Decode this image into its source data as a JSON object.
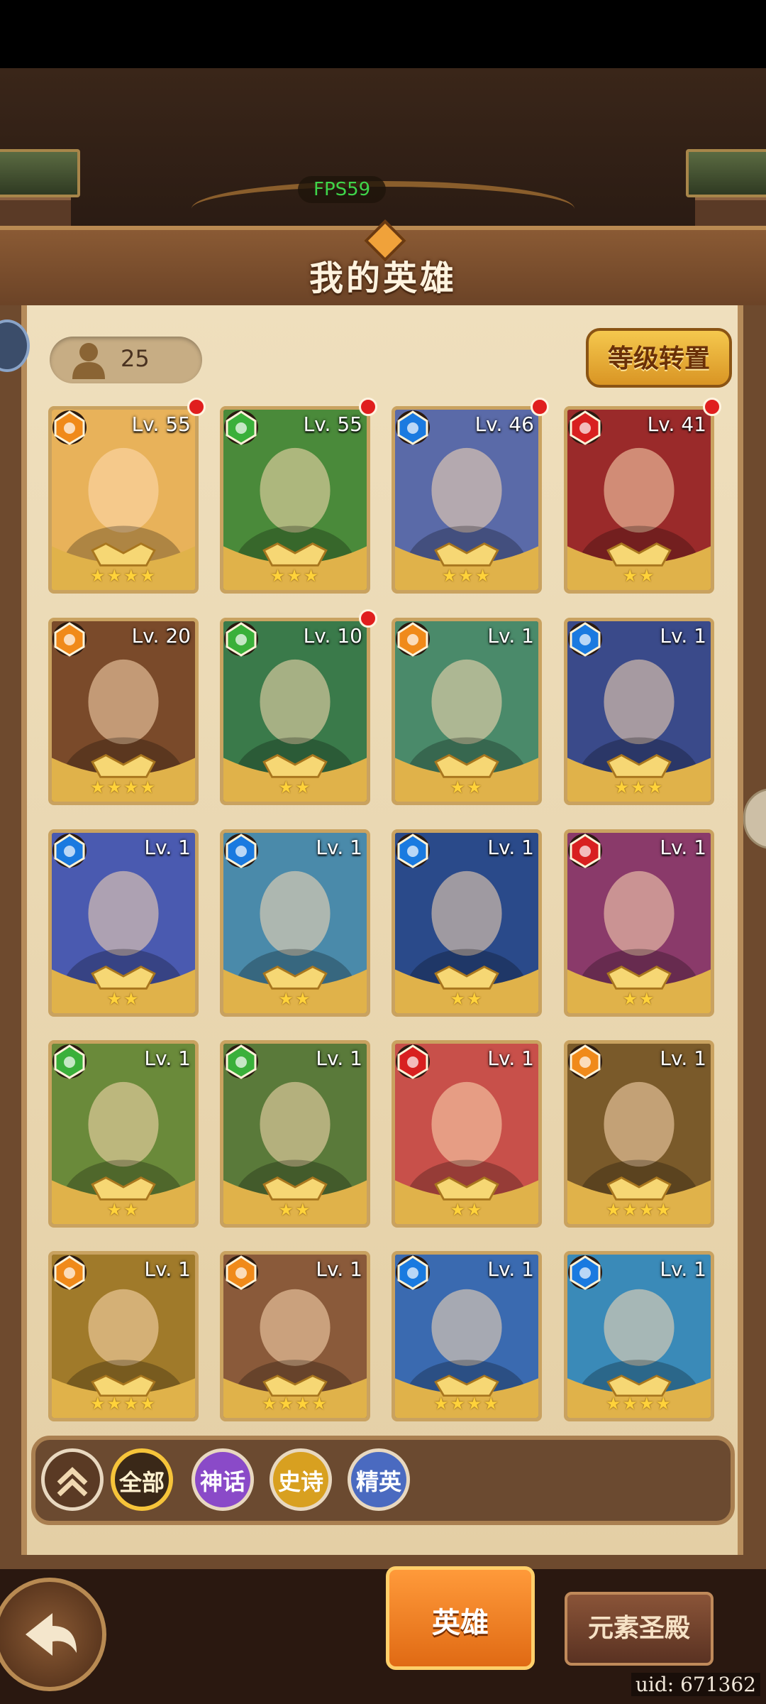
{
  "fps_label": "FPS59",
  "title": "我的英雄",
  "hero_count": "25",
  "level_reset_label": "等级转置",
  "heroes": [
    {
      "level": "Lv. 55",
      "element": "light",
      "stars": "★★★★",
      "badge": true,
      "bg": "#e8b25a"
    },
    {
      "level": "Lv. 55",
      "element": "nature",
      "stars": "★★★",
      "badge": true,
      "bg": "#4a8a3a"
    },
    {
      "level": "Lv. 46",
      "element": "water",
      "stars": "★★★",
      "badge": true,
      "bg": "#5a6aa8"
    },
    {
      "level": "Lv. 41",
      "element": "fire",
      "stars": "★★",
      "badge": true,
      "bg": "#9a2a2a"
    },
    {
      "level": "Lv. 20",
      "element": "light",
      "stars": "★★★★",
      "badge": false,
      "bg": "#7a4a2a"
    },
    {
      "level": "Lv. 10",
      "element": "nature",
      "stars": "★★",
      "badge": true,
      "bg": "#3a7a4a"
    },
    {
      "level": "Lv. 1",
      "element": "light",
      "stars": "★★",
      "badge": false,
      "bg": "#4a8a6a"
    },
    {
      "level": "Lv. 1",
      "element": "water",
      "stars": "★★★",
      "badge": false,
      "bg": "#3a4a8a"
    },
    {
      "level": "Lv. 1",
      "element": "water",
      "stars": "★★",
      "badge": false,
      "bg": "#4a5ab0"
    },
    {
      "level": "Lv. 1",
      "element": "water",
      "stars": "★★",
      "badge": false,
      "bg": "#4a8aaa"
    },
    {
      "level": "Lv. 1",
      "element": "water",
      "stars": "★★",
      "badge": false,
      "bg": "#2a4a8a"
    },
    {
      "level": "Lv. 1",
      "element": "fire",
      "stars": "★★",
      "badge": false,
      "bg": "#8a3a6a"
    },
    {
      "level": "Lv. 1",
      "element": "nature",
      "stars": "★★",
      "badge": false,
      "bg": "#6a8a3a"
    },
    {
      "level": "Lv. 1",
      "element": "nature",
      "stars": "★★",
      "badge": false,
      "bg": "#5a7a3a"
    },
    {
      "level": "Lv. 1",
      "element": "fire",
      "stars": "★★",
      "badge": false,
      "bg": "#c8504a"
    },
    {
      "level": "Lv. 1",
      "element": "light",
      "stars": "★★★★",
      "badge": false,
      "bg": "#7a5a2a"
    },
    {
      "level": "Lv. 1",
      "element": "light",
      "stars": "★★★★",
      "badge": false,
      "bg": "#a07a2a"
    },
    {
      "level": "Lv. 1",
      "element": "light",
      "stars": "★★★★",
      "badge": false,
      "bg": "#8a5a3a"
    },
    {
      "level": "Lv. 1",
      "element": "water",
      "stars": "★★★★",
      "badge": false,
      "bg": "#3a6ab0"
    },
    {
      "level": "Lv. 1",
      "element": "water",
      "stars": "★★★★",
      "badge": false,
      "bg": "#3a8ab8"
    }
  ],
  "element_colors": {
    "light": "#f08a1a",
    "nature": "#3ab03a",
    "water": "#1a7ae0",
    "fire": "#d82020"
  },
  "filters": [
    {
      "label": "",
      "name": "collapse-filter-button",
      "icon": "double-chevron-up-icon",
      "color": "#5a3a24",
      "text_color": "#f0d8b0"
    },
    {
      "label": "全部",
      "name": "filter-all-button",
      "color": "#3a2818",
      "text_color": "#fff1d0",
      "selected": true
    },
    {
      "label": "神话",
      "name": "filter-mythic-button",
      "color": "#8a4ac8",
      "text_color": "#ffffff"
    },
    {
      "label": "史诗",
      "name": "filter-epic-button",
      "color": "#d8a020",
      "text_color": "#fff"
    },
    {
      "label": "精英",
      "name": "filter-elite-button",
      "color": "#4a6ac0",
      "text_color": "#ffffff"
    }
  ],
  "tabs": {
    "hero": "英雄",
    "temple": "元素圣殿"
  },
  "uid": "uid: 671362"
}
